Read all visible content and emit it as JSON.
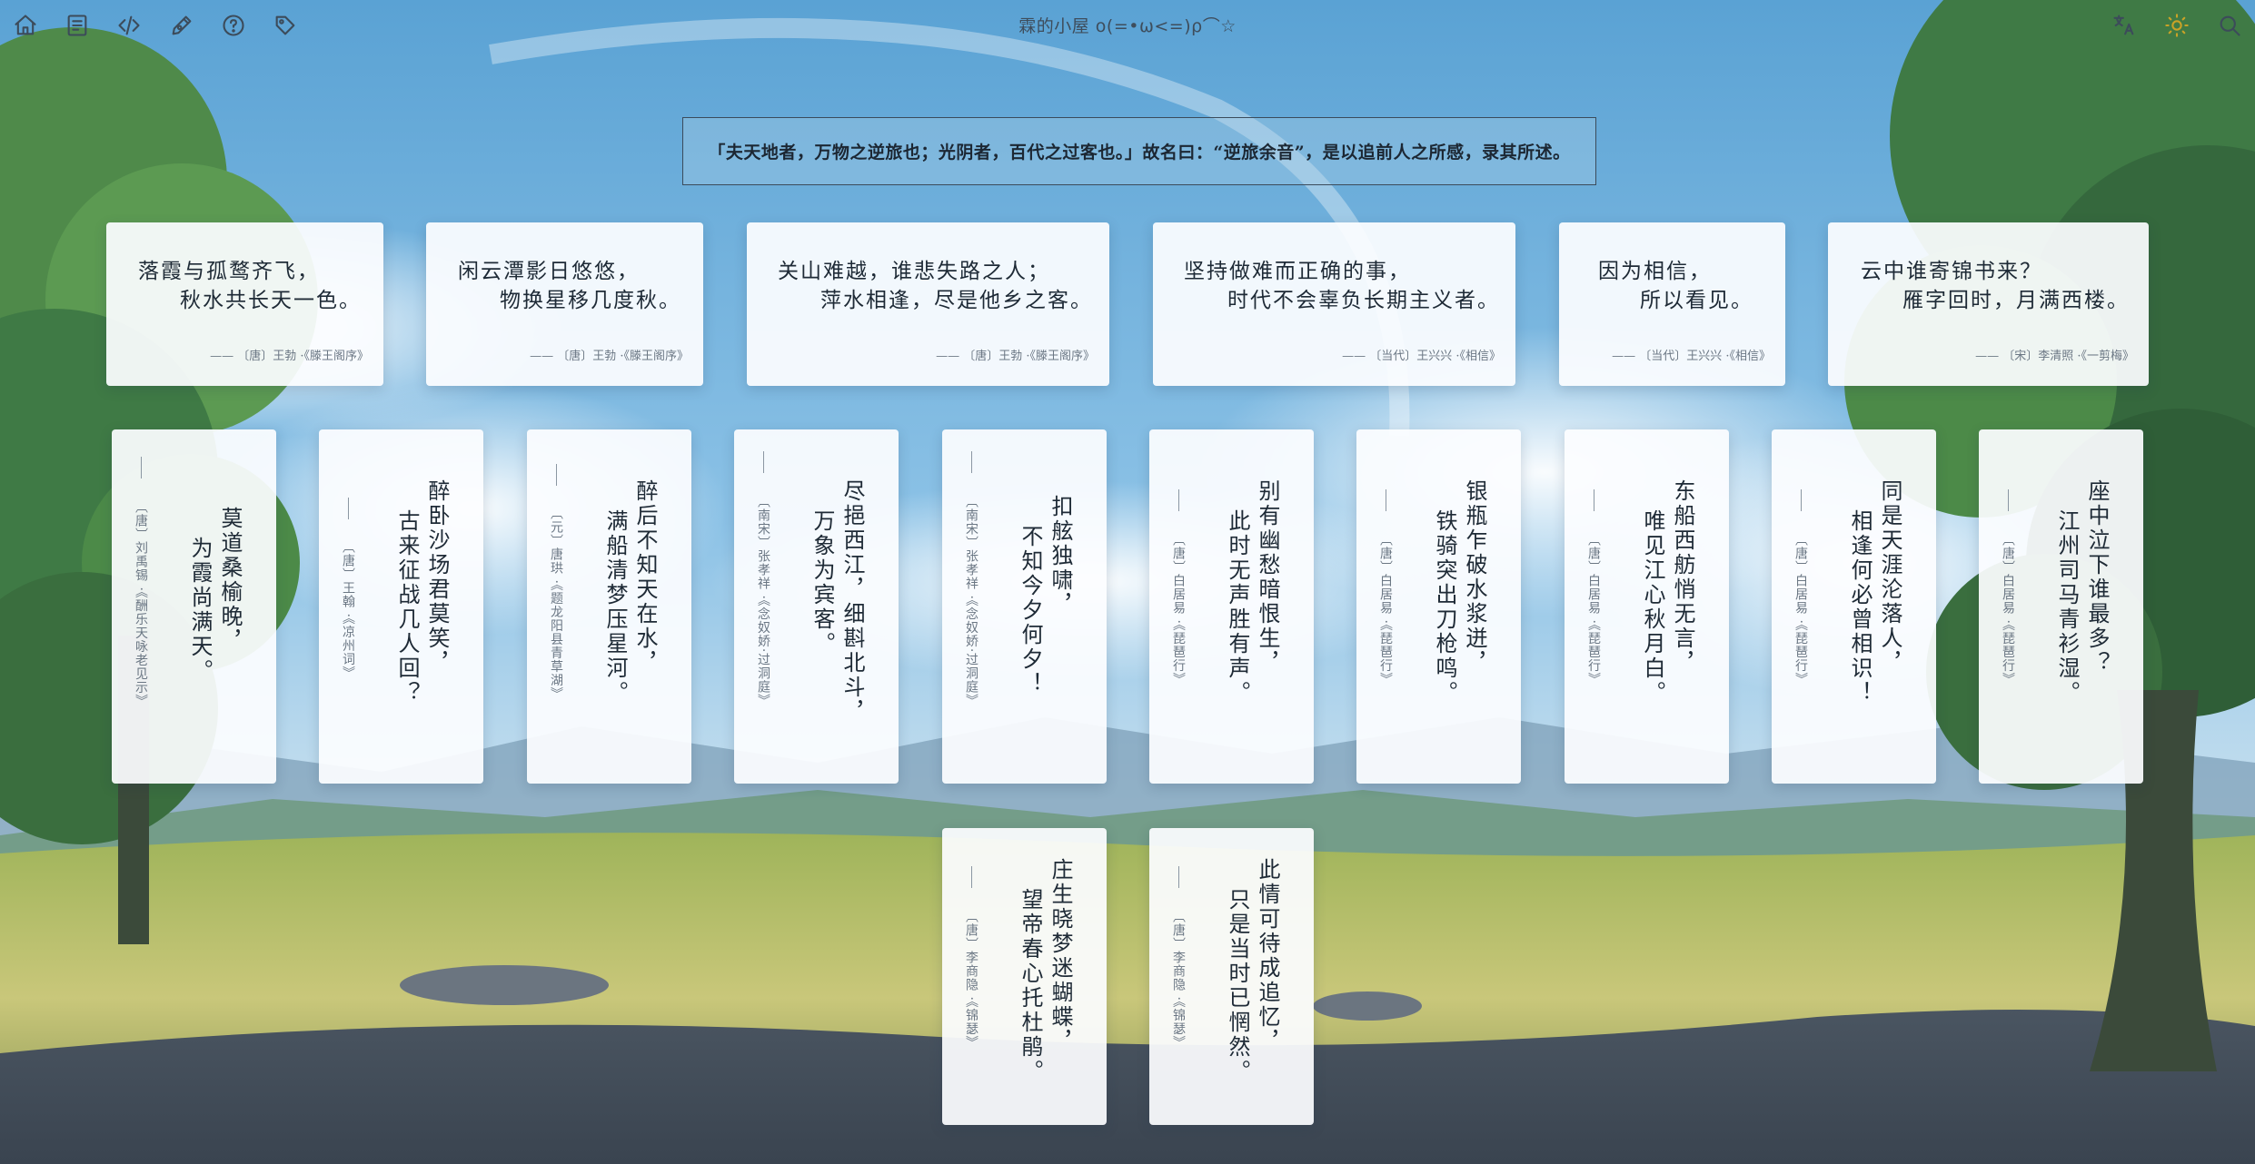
{
  "topbar": {
    "title": "霖的小屋 o(=•ω<=)ρ⌒☆",
    "left_icons": [
      "home-icon",
      "document-icon",
      "code-icon",
      "pen-icon",
      "help-icon",
      "tag-icon"
    ],
    "right_icons": [
      "translate-icon",
      "sun-icon",
      "search-icon"
    ]
  },
  "banner": {
    "text": "「夫天地者，万物之逆旅也；光阴者，百代之过客也。」故名曰：“逆旅余音”，是以追前人之所感，录其所述。"
  },
  "horizontal_cards": [
    {
      "line1": "落霞与孤鹜齐飞，",
      "line2": "秋水共长天一色。",
      "source": "—— 〔唐〕王勃 ·《滕王阁序》"
    },
    {
      "line1": "闲云潭影日悠悠，",
      "line2": "物换星移几度秋。",
      "source": "—— 〔唐〕王勃 ·《滕王阁序》"
    },
    {
      "line1": "关山难越，谁悲失路之人；",
      "line2": "萍水相逢，尽是他乡之客。",
      "source": "—— 〔唐〕王勃 ·《滕王阁序》"
    },
    {
      "line1": "坚持做难而正确的事，",
      "line2": "时代不会辜负长期主义者。",
      "source": "—— 〔当代〕王兴兴 ·《相信》"
    },
    {
      "line1": "因为相信，",
      "line2": "所以看见。",
      "source": "—— 〔当代〕王兴兴 ·《相信》"
    },
    {
      "line1": "云中谁寄锦书来？",
      "line2": "雁字回时，月满西楼。",
      "source": "—— 〔宋〕李清照 ·《一剪梅》"
    }
  ],
  "vertical_cards": [
    {
      "line1": "莫道桑榆晚，",
      "line2": "为霞尚满天。",
      "source": "〔唐〕刘禹锡 ·《酬乐天咏老见示》"
    },
    {
      "line1": "醉卧沙场君莫笑，",
      "line2": "古来征战几人回？",
      "source": "〔唐〕王翰 ·《凉州词》"
    },
    {
      "line1": "醉后不知天在水，",
      "line2": "满船清梦压星河。",
      "source": "〔元〕唐珙 ·《题龙阳县青草湖》"
    },
    {
      "line1": "尽挹西江，细斟北斗，",
      "line2": "万象为宾客。",
      "source": "〔南宋〕张孝祥 ·《念奴娇·过洞庭》"
    },
    {
      "line1": "扣舷独啸，",
      "line2": "不知今夕何夕！",
      "source": "〔南宋〕张孝祥 ·《念奴娇·过洞庭》"
    },
    {
      "line1": "别有幽愁暗恨生，",
      "line2": "此时无声胜有声。",
      "source": "〔唐〕白居易 ·《琵琶行》"
    },
    {
      "line1": "银瓶乍破水浆迸，",
      "line2": "铁骑突出刀枪鸣。",
      "source": "〔唐〕白居易 ·《琵琶行》"
    },
    {
      "line1": "东船西舫悄无言，",
      "line2": "唯见江心秋月白。",
      "source": "〔唐〕白居易 ·《琵琶行》"
    },
    {
      "line1": "同是天涯沦落人，",
      "line2": "相逢何必曾相识！",
      "source": "〔唐〕白居易 ·《琵琶行》"
    },
    {
      "line1": "座中泣下谁最多？",
      "line2": "江州司马青衫湿。",
      "source": "〔唐〕白居易 ·《琵琶行》"
    }
  ],
  "bottom_cards": [
    {
      "line1": "庄生晓梦迷蝴蝶，",
      "line2": "望帝春心托杜鹃。",
      "source": "〔唐〕李商隐 ·《锦瑟》"
    },
    {
      "line1": "此情可待成追忆，",
      "line2": "只是当时已惘然。",
      "source": "〔唐〕李商隐 ·《锦瑟》"
    }
  ]
}
